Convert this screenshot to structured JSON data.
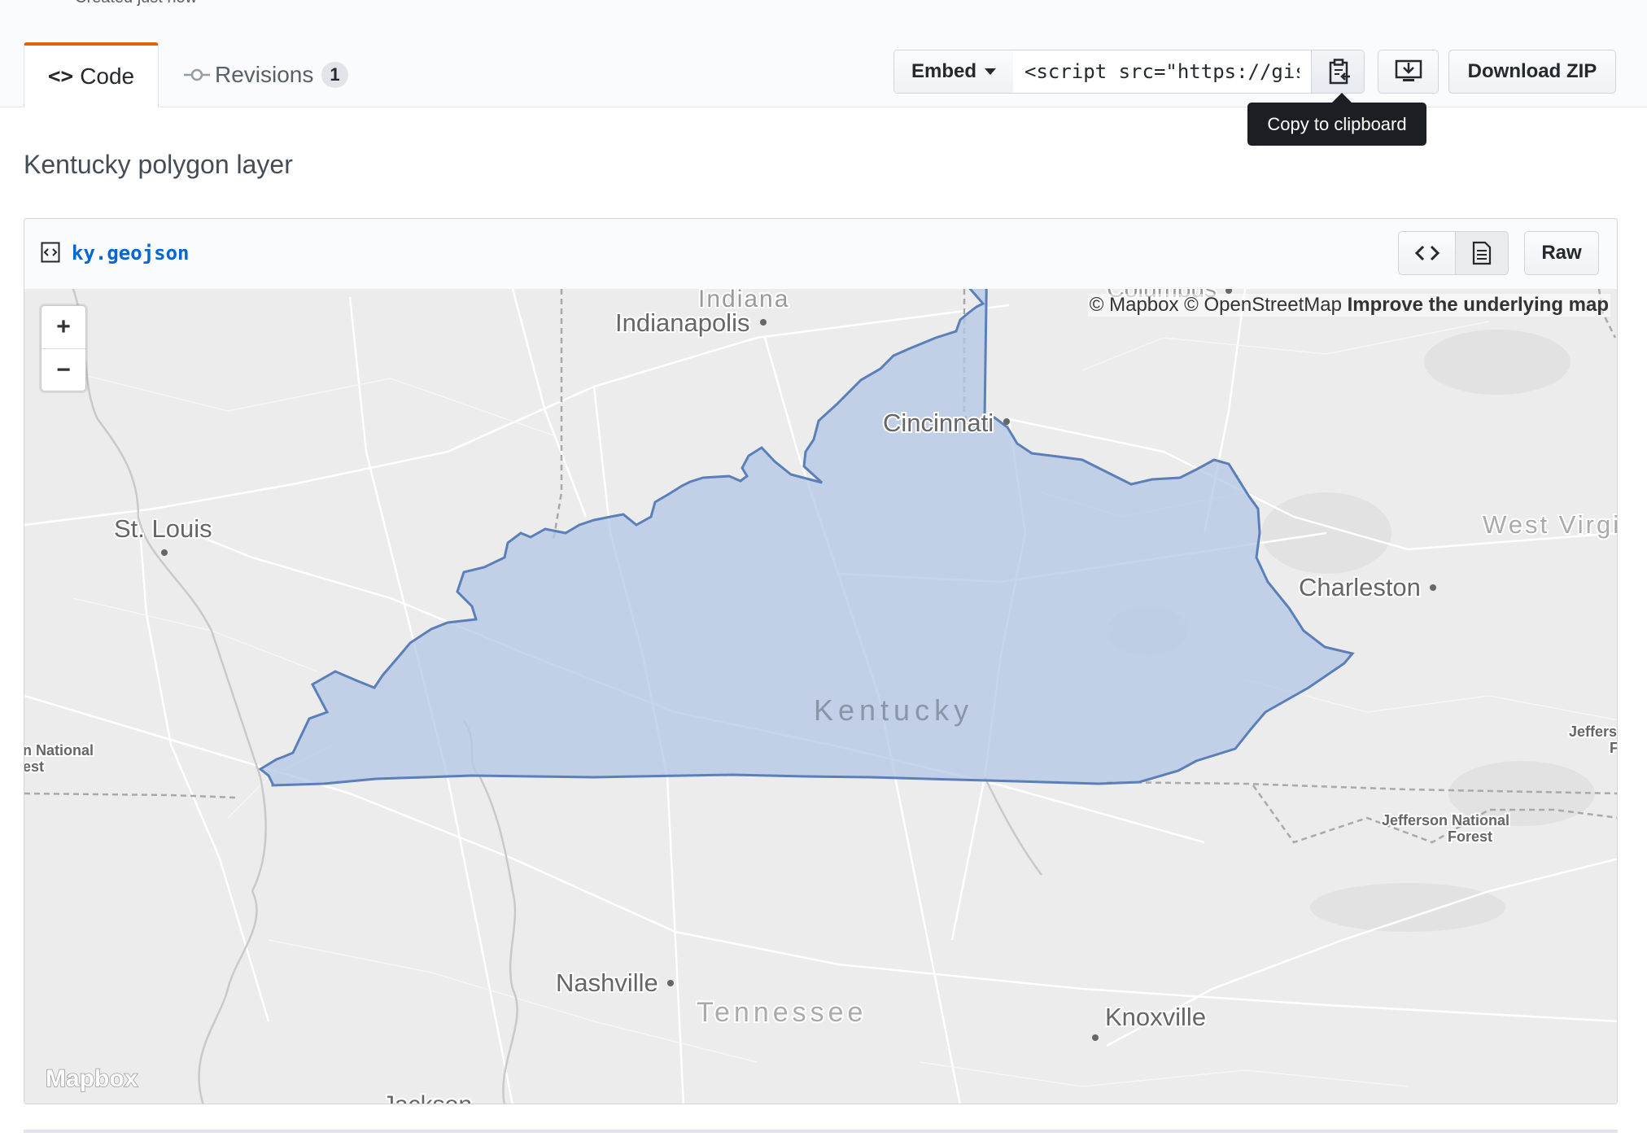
{
  "header": {
    "created_text": "Created just now"
  },
  "tabs": [
    {
      "label": "Code"
    },
    {
      "label": "Revisions",
      "count": "1"
    }
  ],
  "toolbar": {
    "embed_label": "Embed",
    "embed_value": "<script src=\"https://gist.github.com/",
    "tooltip": "Copy to clipboard",
    "download_zip": "Download ZIP"
  },
  "gist": {
    "description": "Kentucky polygon layer"
  },
  "file": {
    "name": "ky.geojson",
    "raw_label": "Raw"
  },
  "map": {
    "zoom_in": "+",
    "zoom_out": "−",
    "attribution": {
      "mapbox": "© Mapbox",
      "osm": "© OpenStreetMap",
      "improve": "Improve the underlying map"
    },
    "logo": "Mapbox",
    "labels": {
      "indiana": "Indiana",
      "indianapolis": "Indianapolis",
      "columbus": "Columbus",
      "cincinnati": "Cincinnati",
      "st_louis": "St. Louis",
      "west_virginia": "West Virgi",
      "charleston": "Charleston",
      "kentucky": "Kentucky",
      "jefferson_right_1": "Jeffers",
      "jefferson_right_2": "F",
      "national_forest_left_1": "n National",
      "national_forest_left_2": "est",
      "jefferson_nf_1": "Jefferson National",
      "jefferson_nf_2": "Forest",
      "nashville": "Nashville",
      "tennessee": "Tennessee",
      "knoxville": "Knoxville",
      "jackson": "Jackson"
    },
    "colors": {
      "polygon_fill": "#b3c5e6",
      "polygon_stroke": "#5b7fb8",
      "land": "#ececec"
    }
  }
}
